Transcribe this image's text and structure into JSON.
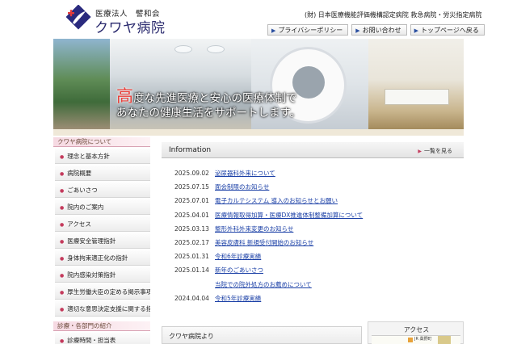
{
  "header": {
    "org": "医療法人　譬和会",
    "hospital_name": "クワヤ病院",
    "accreditation": "(財) 日本医療機能評価機構認定病院 救急病院・労災指定病院",
    "links": [
      "プライバシーポリシー",
      "お問い合わせ",
      "トップページへ戻る"
    ]
  },
  "hero": {
    "line1_big": "高",
    "line1_rest": "度な先進医療と安心の医療体制で",
    "line2": "あなたの健康生活をサポートします。"
  },
  "sidebar": {
    "section1_title": "クワヤ病院について",
    "items": [
      "理念と基本方針",
      "病院概要",
      "ごあいさつ",
      "院内のご案内",
      "アクセス",
      "医療安全管理指針",
      "身体拘束適正化の指針",
      "院内感染対策指針",
      "厚生労働大臣の定める掲示事項",
      "適切な意思決定支援に関する指針"
    ],
    "section2_title": "診療・各部門の紹介",
    "section2_items": [
      "診療時間・担当表"
    ]
  },
  "info": {
    "title": "Information",
    "more": "一覧を見る",
    "news": [
      {
        "date": "2025.09.02",
        "text": "泌尿器科外来について"
      },
      {
        "date": "2025.07.15",
        "text": "面会制限のお知らせ"
      },
      {
        "date": "2025.07.01",
        "text": "電子カルテシステム 導入のお知らせとお願い"
      },
      {
        "date": "2025.04.01",
        "text": "医療情報取得加算・医療DX推進体制整備加算について"
      },
      {
        "date": "2025.03.13",
        "text": "整形外科外来変更のお知らせ"
      },
      {
        "date": "2025.02.17",
        "text": "美容皮膚科 新規受付開始のお知らせ"
      },
      {
        "date": "2025.01.31",
        "text": "令和6年診療実績"
      },
      {
        "date": "2025.01.14",
        "text": "新年のごあいさつ"
      },
      {
        "date": "",
        "text": "当院での院外処方のお薦めについて"
      },
      {
        "date": "2024.04.04",
        "text": "令和5年診療実績"
      }
    ]
  },
  "about": {
    "title": "クワヤ病院より"
  },
  "access": {
    "title": "アクセス",
    "map_label": "JR 桑野町"
  },
  "colors": {
    "accent": "#c43a5c",
    "link": "#1a3fa6",
    "hero_highlight": "#e8403a"
  }
}
